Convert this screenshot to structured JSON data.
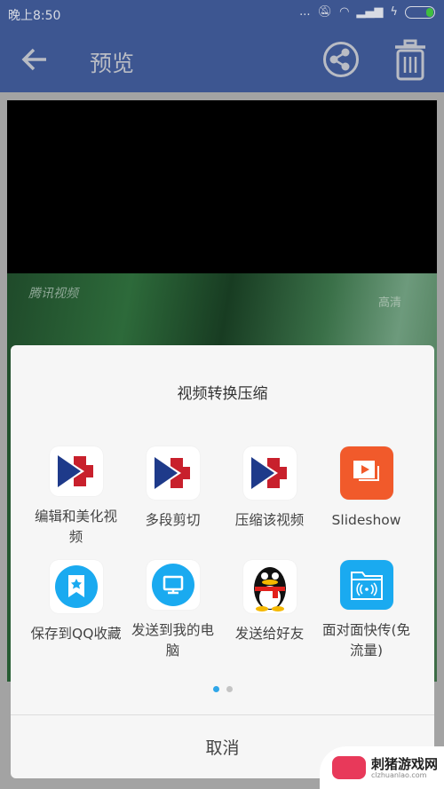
{
  "status_bar": {
    "time": "晚上8:50",
    "more": "...",
    "icons": [
      "mute-bell-icon",
      "wifi-icon",
      "signal-icon",
      "charging-icon",
      "battery-icon"
    ]
  },
  "app_bar": {
    "title": "预览",
    "back_icon": "arrow-left-icon",
    "share_icon": "share-icon",
    "delete_icon": "trash-icon"
  },
  "video": {
    "watermark": "腾讯视频",
    "quality": "高清"
  },
  "dialog": {
    "title": "视频转换压缩",
    "items": [
      {
        "label": "编辑和美化视频",
        "icon": "video-editor-app-icon"
      },
      {
        "label": "多段剪切",
        "icon": "video-editor-app-icon"
      },
      {
        "label": "压缩该视频",
        "icon": "video-editor-app-icon"
      },
      {
        "label": "Slideshow",
        "icon": "slideshow-icon"
      },
      {
        "label": "保存到QQ收藏",
        "icon": "qq-favorite-icon"
      },
      {
        "label": "发送到我的电脑",
        "icon": "send-to-computer-icon"
      },
      {
        "label": "发送给好友",
        "icon": "qq-penguin-icon"
      },
      {
        "label": "面对面快传(免流量)",
        "icon": "face-to-face-transfer-icon"
      }
    ],
    "page": 1,
    "pages": 2,
    "cancel": "取消"
  },
  "watermark_site": {
    "name": "刺猪游戏网",
    "url": "clzhuanlao.com"
  },
  "colors": {
    "app_bar": "#3d5691",
    "page_dot_active": "#2fa6e8",
    "slideshow": "#f15a2b",
    "qq_blue": "#1aaaf0"
  }
}
